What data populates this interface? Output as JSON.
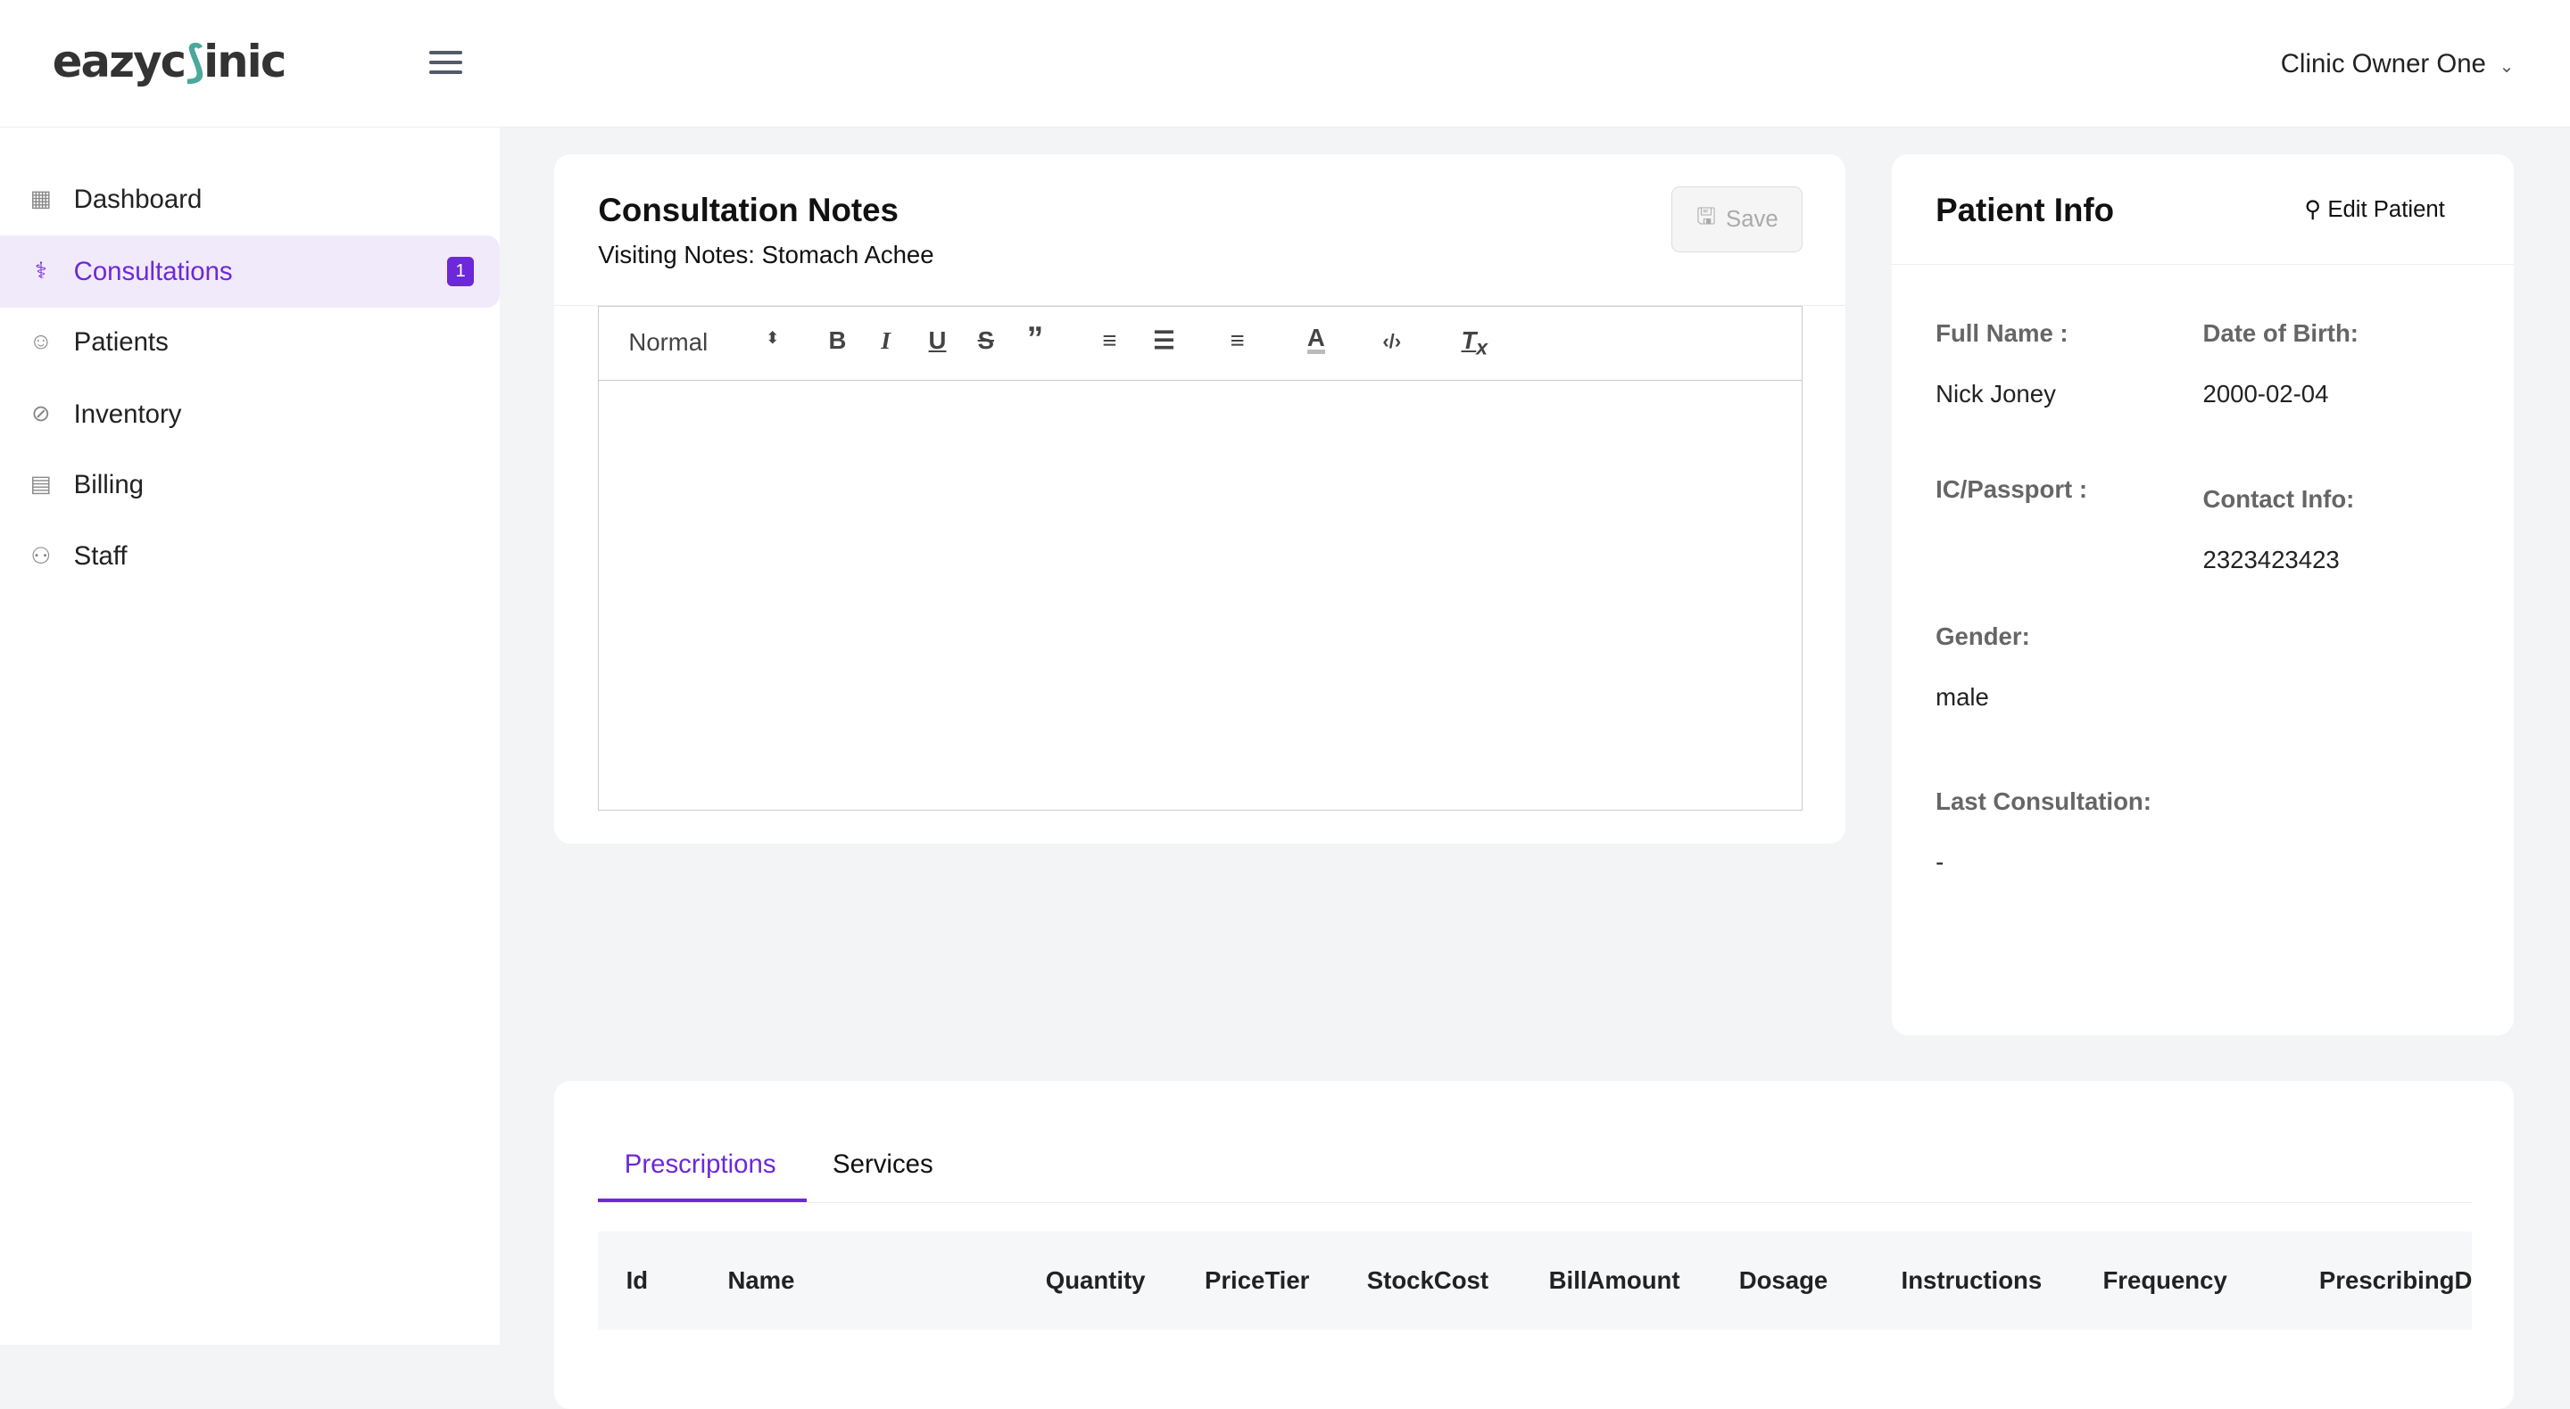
{
  "header": {
    "logo": "eazyclinic",
    "user": "Clinic Owner One"
  },
  "sidebar": {
    "items": [
      {
        "label": "Dashboard",
        "icon": "grid-icon"
      },
      {
        "label": "Consultations",
        "icon": "stethoscope-icon",
        "badge": "1",
        "active": true
      },
      {
        "label": "Patients",
        "icon": "smile-icon"
      },
      {
        "label": "Inventory",
        "icon": "pill-icon"
      },
      {
        "label": "Billing",
        "icon": "receipt-icon"
      },
      {
        "label": "Staff",
        "icon": "users-icon"
      }
    ]
  },
  "notes": {
    "title": "Consultation Notes",
    "subtitle": "Visiting Notes: Stomach Achee",
    "save": "Save",
    "format": "Normal",
    "content": ""
  },
  "patient": {
    "title": "Patient Info",
    "edit": "Edit Patient",
    "full_name_label": "Full Name :",
    "full_name": "Nick Joney",
    "dob_label": "Date of Birth:",
    "dob": "2000-02-04",
    "ic_label": "IC/Passport :",
    "ic": "",
    "contact_label": "Contact Info:",
    "contact": "2323423423",
    "gender_label": "Gender:",
    "gender": "male",
    "last_label": "Last Consultation:",
    "last": "-"
  },
  "tabs": {
    "items": [
      "Prescriptions",
      "Services"
    ],
    "active": "Prescriptions"
  },
  "table": {
    "columns": [
      "Id",
      "Name",
      "Quantity",
      "PriceTier",
      "StockCost",
      "BillAmount",
      "Dosage",
      "Instructions",
      "Frequency",
      "PrescribingD"
    ]
  },
  "colors": {
    "accent": "#6d28d9"
  }
}
